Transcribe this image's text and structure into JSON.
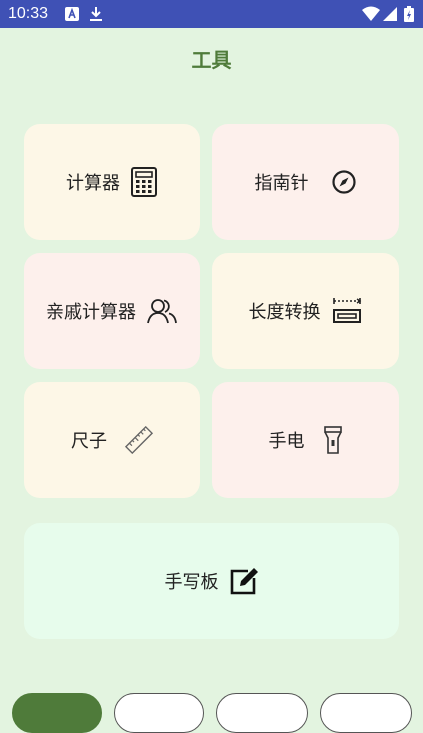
{
  "status": {
    "time": "10:33"
  },
  "header": {
    "title": "工具"
  },
  "tools": {
    "calculator": "计算器",
    "compass": "指南针",
    "relative_calculator": "亲戚计算器",
    "length_convert": "长度转换",
    "ruler": "尺子",
    "flashlight": "手电",
    "handwriting_board": "手写板"
  },
  "colors": {
    "accent": "#4f7b3a",
    "background": "#e3f4e0",
    "statusbar": "#3f51b5"
  }
}
